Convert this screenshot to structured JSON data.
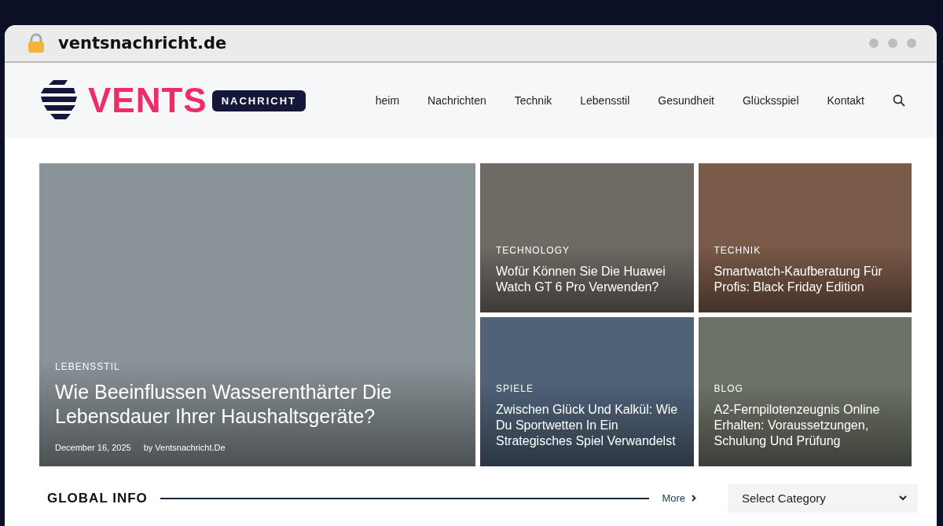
{
  "browser": {
    "url": "ventsnachricht.de"
  },
  "logo": {
    "word": "VENTS",
    "badge": "NACHRICHT"
  },
  "nav": [
    {
      "label": "heim"
    },
    {
      "label": "Nachrichten"
    },
    {
      "label": "Technik"
    },
    {
      "label": "Lebensstil"
    },
    {
      "label": "Gesundheit"
    },
    {
      "label": "Glücksspiel"
    },
    {
      "label": "Kontakt"
    }
  ],
  "featured": {
    "category": "LEBENSSTIL",
    "title": "Wie Beeinflussen Wasserenthärter Die Lebensdauer Ihrer Haushaltsgeräte?",
    "date": "December 16, 2025",
    "author": "by Ventsnachricht.De",
    "color": "#8a9398"
  },
  "cards": [
    {
      "category": "TECHNOLOGY",
      "title": "Wofür Können Sie Die Huawei Watch GT 6 Pro Verwenden?",
      "color": "#6f6a64"
    },
    {
      "category": "TECHNIK",
      "title": "Smartwatch-Kaufberatung Für Profis: Black Friday Edition",
      "color": "#7a5a48"
    },
    {
      "category": "SPIELE",
      "title": "Zwischen Glück Und Kalkül: Wie Du Sportwetten In Ein Strategisches Spiel Verwandelst",
      "color": "#4f6278"
    },
    {
      "category": "BLOG",
      "title": "A2-Fernpilotenzeugnis Online Erhalten: Voraussetzungen, Schulung Und Prüfung",
      "color": "#6c7266"
    }
  ],
  "section": {
    "title": "GLOBAL INFO",
    "more": "More"
  },
  "category_select": {
    "value": "Select Category"
  }
}
